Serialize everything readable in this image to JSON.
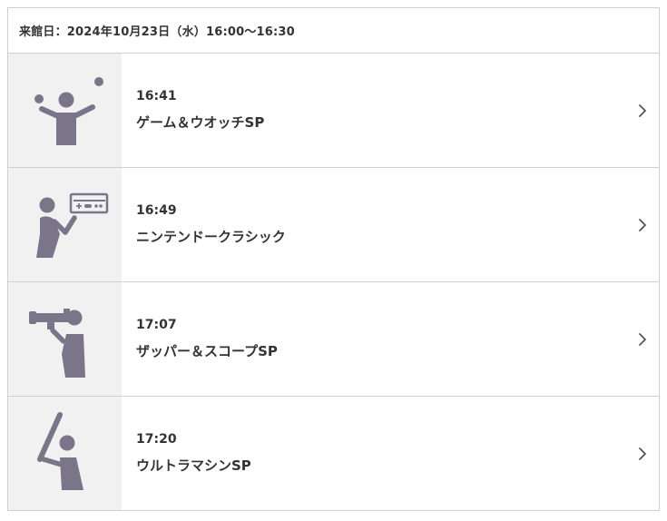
{
  "header": {
    "visit_label": "来館日：2024年10月23日（水）16:00〜16:30"
  },
  "items": [
    {
      "time": "16:41",
      "title": "ゲーム＆ウオッチSP",
      "icon": "juggling-person-icon"
    },
    {
      "time": "16:49",
      "title": "ニンテンドークラシック",
      "icon": "person-with-game-controller-icon"
    },
    {
      "time": "17:07",
      "title": "ザッパー＆スコープSP",
      "icon": "person-with-zapper-scope-icon"
    },
    {
      "time": "17:20",
      "title": "ウルトラマシンSP",
      "icon": "person-swinging-bat-icon"
    }
  ],
  "colors": {
    "icon": "#7a7588",
    "thumb_bg": "#f1f1f1",
    "border": "#cfcfcf",
    "text": "#333333",
    "chevron": "#555555"
  }
}
